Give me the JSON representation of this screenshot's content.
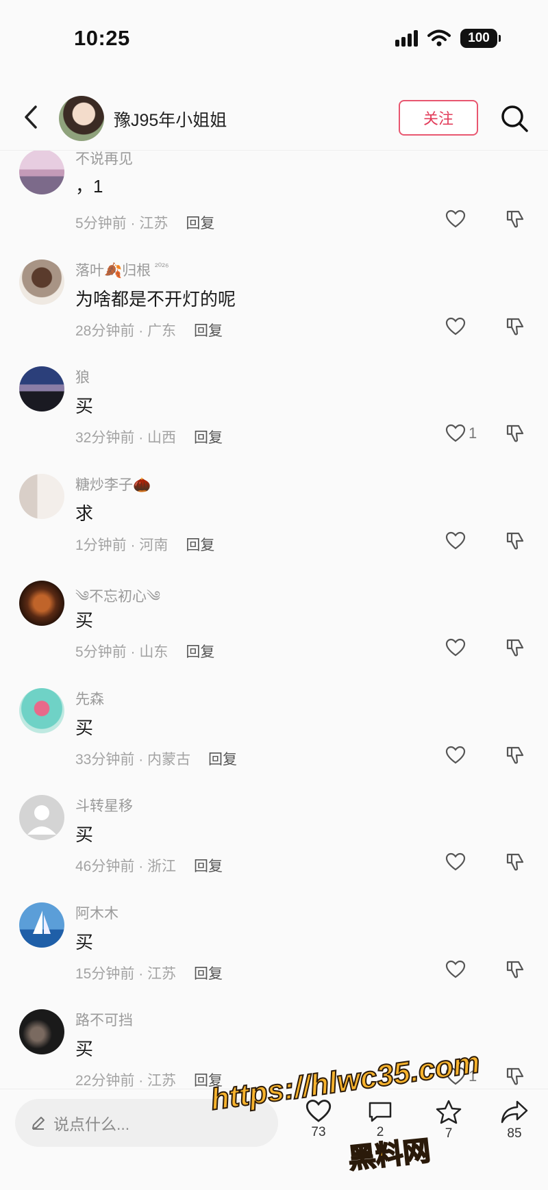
{
  "status_bar": {
    "time": "10:25",
    "battery": "100"
  },
  "header": {
    "username": "豫J95年小姐姐",
    "follow_label": "关注"
  },
  "comments": [
    {
      "name": "不说再见",
      "badge": "",
      "text": "，1",
      "time": "5分钟前",
      "location": "江苏",
      "reply": "回复",
      "likes": ""
    },
    {
      "name": "落叶🍂归根",
      "badge": "²⁰²⁶",
      "text": "为啥都是不开灯的呢",
      "time": "28分钟前",
      "location": "广东",
      "reply": "回复",
      "likes": ""
    },
    {
      "name": "狼",
      "badge": "",
      "text": "买",
      "time": "32分钟前",
      "location": "山西",
      "reply": "回复",
      "likes": "1"
    },
    {
      "name": "糖炒李子🌰",
      "badge": "",
      "text": "求",
      "time": "1分钟前",
      "location": "河南",
      "reply": "回复",
      "likes": ""
    },
    {
      "name": "༄不忘初心༄",
      "badge": "",
      "text": "买",
      "time": "5分钟前",
      "location": "山东",
      "reply": "回复",
      "likes": ""
    },
    {
      "name": "先森",
      "badge": "",
      "text": "买",
      "time": "33分钟前",
      "location": "内蒙古",
      "reply": "回复",
      "likes": ""
    },
    {
      "name": "斗转星移",
      "badge": "",
      "text": "买",
      "time": "46分钟前",
      "location": "浙江",
      "reply": "回复",
      "likes": ""
    },
    {
      "name": "阿木木",
      "badge": "",
      "text": "买",
      "time": "15分钟前",
      "location": "江苏",
      "reply": "回复",
      "likes": ""
    },
    {
      "name": "路不可挡",
      "badge": "",
      "text": "买",
      "time": "22分钟前",
      "location": "江苏",
      "reply": "回复",
      "likes": "1"
    }
  ],
  "bottom_bar": {
    "input_placeholder": "说点什么...",
    "like_count": "73",
    "comment_count": "2",
    "favorite_count": "7",
    "share_count": "85"
  },
  "watermark": {
    "url": "https://hlwc35.com",
    "site": "黑料网"
  },
  "colors": {
    "accent": "#e23c5a",
    "watermark": "#f7b32d"
  },
  "icons": [
    "back-icon",
    "search-icon",
    "heart-icon",
    "dislike-icon",
    "pencil-icon",
    "star-icon",
    "share-icon",
    "comment-icon"
  ]
}
